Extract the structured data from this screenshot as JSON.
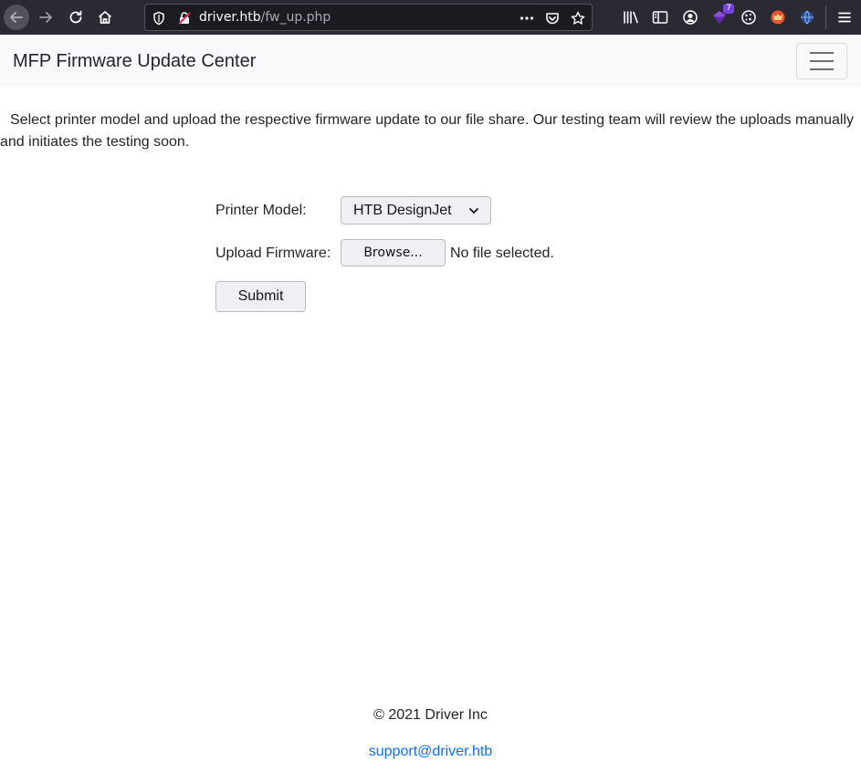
{
  "browser": {
    "url_host": "driver.htb",
    "url_path": "/fw_up.php",
    "extension_badge": "7"
  },
  "navbar": {
    "brand": "MFP Firmware Update Center"
  },
  "main": {
    "intro": "Select printer model and upload the respective firmware update to our file share. Our testing team will review the uploads manually and initiates the testing soon.",
    "printer_model_label": "Printer Model:",
    "printer_model_value": "HTB DesignJet",
    "upload_label": "Upload Firmware:",
    "browse_label": "Browse...",
    "file_status": "No file selected.",
    "submit_label": "Submit"
  },
  "footer": {
    "copyright": "© 2021 Driver Inc",
    "email": "support@driver.htb"
  }
}
